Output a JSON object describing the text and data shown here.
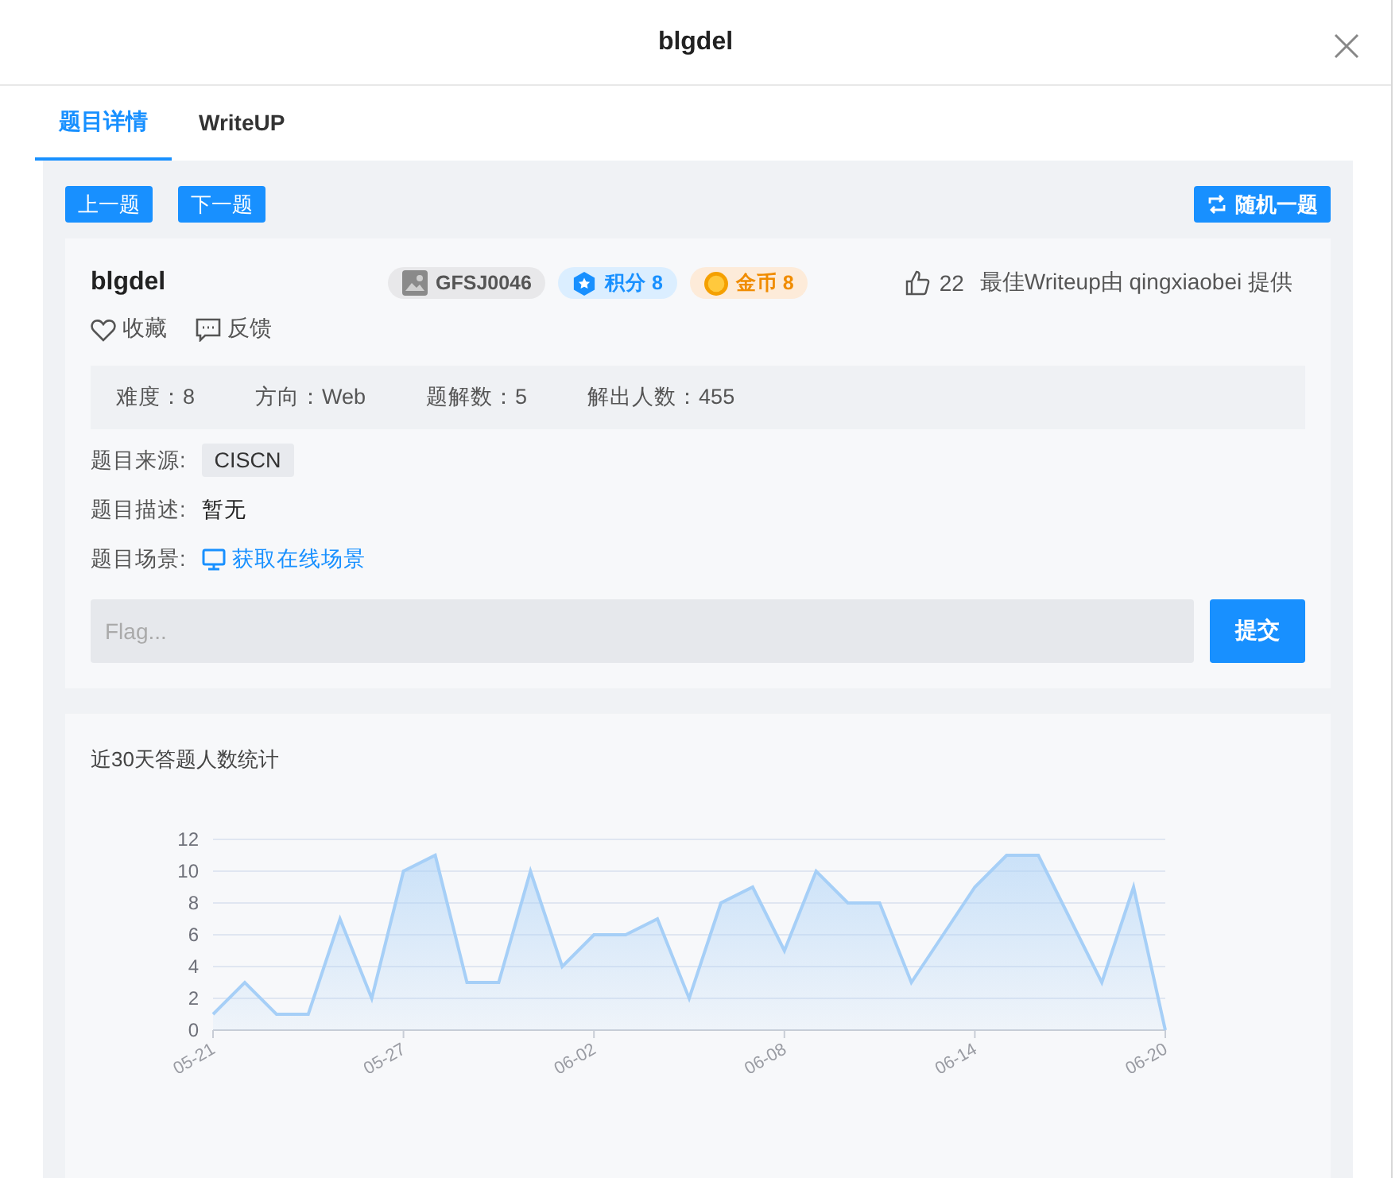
{
  "dialog": {
    "title": "blgdel"
  },
  "tabs": [
    {
      "label": "题目详情",
      "selected": true
    },
    {
      "label": "WriteUP",
      "selected": false
    }
  ],
  "nav_buttons": [
    "上一题",
    "下一题"
  ],
  "random_button": "随机一题",
  "challenge": {
    "title": "blgdel",
    "badges": [
      {
        "kind": "id",
        "label": "GFSJ0046"
      },
      {
        "kind": "score",
        "label": "积分 8"
      },
      {
        "kind": "coin",
        "label": "金币 8"
      }
    ],
    "likes": "22",
    "best_writeup": "最佳Writeup由 qingxiaobei 提供",
    "actions": [
      {
        "kind": "favorite",
        "label": "收藏"
      },
      {
        "kind": "feedback",
        "label": "反馈"
      }
    ],
    "stats": [
      "难度：8",
      "方向：Web",
      "题解数：5",
      "解出人数：455"
    ],
    "source_label": "题目来源:",
    "source": "CISCN",
    "description_label": "题目描述:",
    "description": "暂无",
    "scene_label": "题目场景:",
    "scene_link": "获取在线场景",
    "flag_input": {
      "placeholder": "Flag..."
    },
    "submit_button": "提交"
  },
  "stats_card": {
    "title": "近30天答题人数统计",
    "chart_data": {
      "type": "area",
      "grid": true,
      "categories": [
        "05-21",
        null,
        null,
        null,
        null,
        null,
        "05-27",
        null,
        null,
        null,
        null,
        null,
        "06-02",
        null,
        null,
        null,
        null,
        null,
        "06-08",
        null,
        null,
        null,
        null,
        null,
        "06-14",
        null,
        null,
        null,
        null,
        null,
        "06-20"
      ],
      "series": [
        {
          "color": "#a6cff7",
          "values": [
            1,
            3,
            1,
            1,
            7,
            2,
            10,
            11,
            3,
            3,
            10,
            4,
            6,
            6,
            7,
            2,
            8,
            9,
            5,
            10,
            8,
            8,
            3,
            6,
            9,
            11,
            11,
            7,
            3,
            9,
            0
          ]
        }
      ],
      "ylim": [
        0,
        12
      ],
      "yticks": [
        0,
        2,
        4,
        6,
        8,
        10,
        12
      ]
    }
  }
}
